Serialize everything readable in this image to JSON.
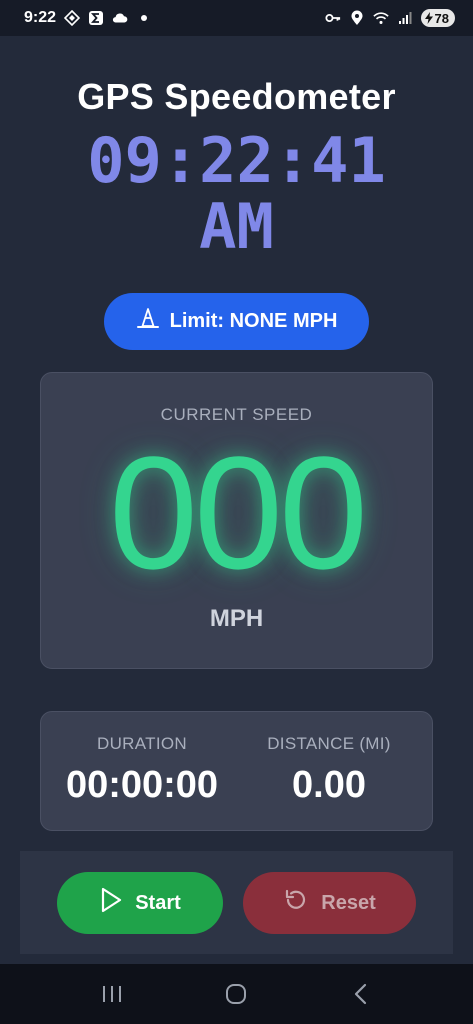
{
  "status_bar": {
    "time": "9:22",
    "battery": "78",
    "left_icons": [
      "proton-icon",
      "sigma-icon",
      "cloud-icon",
      "dot-icon"
    ],
    "right_icons": [
      "key-icon",
      "location-icon",
      "wifi-icon",
      "signal-icon",
      "battery-charging-icon"
    ]
  },
  "app": {
    "title": "GPS Speedometer",
    "clock_time": "09:22:41",
    "clock_ampm": "AM"
  },
  "limit_button": {
    "label": "Limit: NONE MPH",
    "icon": "traffic-cone-icon"
  },
  "speed": {
    "label": "CURRENT SPEED",
    "value": "000",
    "unit": "MPH"
  },
  "stats": {
    "duration_label": "DURATION",
    "duration_value": "00:00:00",
    "distance_label": "DISTANCE (MI)",
    "distance_value": "0.00"
  },
  "controls": {
    "start_label": "Start",
    "start_icon": "play-icon",
    "reset_label": "Reset",
    "reset_icon": "reset-icon"
  },
  "nav": {
    "icons": [
      "recent-apps-icon",
      "home-icon",
      "back-icon"
    ]
  },
  "colors": {
    "background": "#232a3a",
    "clock": "#8088e8",
    "speed": "#34d58f",
    "limit_button": "#2563eb",
    "start_button": "#1fa34a",
    "reset_button": "#8a2f3b"
  }
}
